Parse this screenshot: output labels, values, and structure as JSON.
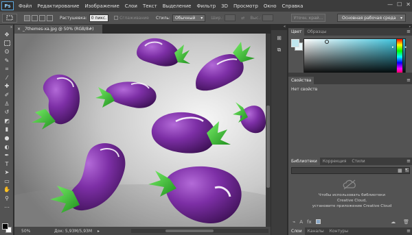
{
  "app": {
    "logo": "Ps"
  },
  "menu": [
    "Файл",
    "Редактирование",
    "Изображение",
    "Слои",
    "Текст",
    "Выделение",
    "Фильтр",
    "3D",
    "Просмотр",
    "Окно",
    "Справка"
  ],
  "window_controls": [
    "—",
    "☐",
    "✕"
  ],
  "options": {
    "feather_label": "Растушевка:",
    "feather_value": "0 пикс.",
    "antialias_label": "Сглаживание",
    "style_label": "Стиль:",
    "style_value": "Обычный",
    "width_label": "Шир.:",
    "height_label": "Выс.:",
    "refine_label": "Уточн. край...",
    "workspace_value": "Основная рабочая среда"
  },
  "document": {
    "tab_title": "_7themes-xa.jpg @ 50% (RGB/8#)",
    "tab_close": "×",
    "zoom": "50%",
    "doc_size": "Док: 5,93M/5,93M"
  },
  "panels": {
    "color_tabs": [
      "Цвет",
      "Образцы"
    ],
    "properties_tab": "Свойства",
    "properties_empty": "Нет свойств",
    "library_tabs": [
      "Библиотеки",
      "Коррекция",
      "Стили"
    ],
    "library_message_1": "Чтобы использовать библиотеки",
    "library_message_2": "Creative Cloud,",
    "library_message_3": "установите приложение Creative Cloud",
    "bottom_tabs": [
      "Слои",
      "Каналы",
      "Контуры"
    ],
    "menu_icon": "≡"
  },
  "colors": {
    "accent": "#2ec0dc",
    "foreground": "#bfe6ee",
    "eggplant": "#7d2fa6",
    "stem": "#2fb82b"
  }
}
